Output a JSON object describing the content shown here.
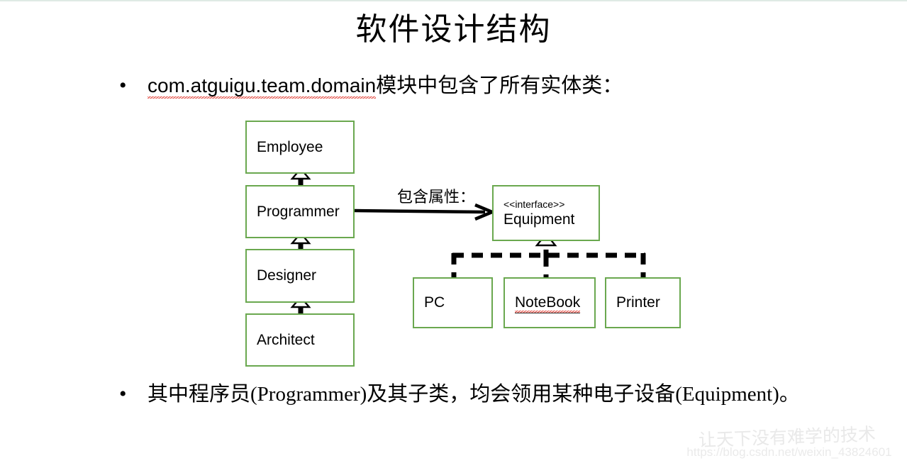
{
  "slide": {
    "title": "软件设计结构",
    "bullets": [
      {
        "marker": "•",
        "code_term": "com.atguigu.team.domain",
        "rest": "模块中包含了所有实体类："
      },
      {
        "marker": "•",
        "text": "其中程序员(Programmer)及其子类，均会领用某种电子设备(Equipment)。"
      }
    ]
  },
  "diagram": {
    "association_label": "包含属性：",
    "boxes": {
      "employee": {
        "name": "Employee"
      },
      "programmer": {
        "name": "Programmer"
      },
      "designer": {
        "name": "Designer"
      },
      "architect": {
        "name": "Architect"
      },
      "equipment": {
        "stereotype": "<<interface>>",
        "name": "Equipment"
      },
      "pc": {
        "name": "PC"
      },
      "notebook": {
        "name": "NoteBook"
      },
      "printer": {
        "name": "Printer"
      }
    },
    "colors": {
      "box_border": "#6aa84f",
      "connector": "#000000",
      "spellcheck_underline": "#e03a2f"
    }
  },
  "watermark": {
    "text": "让天下没有难学的技术",
    "url": "https://blog.csdn.net/weixin_43824601"
  }
}
